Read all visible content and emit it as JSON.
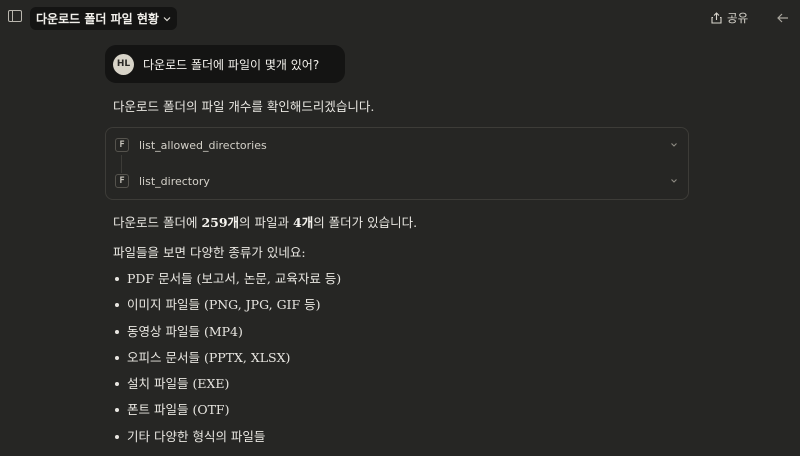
{
  "header": {
    "sidebar_icon": "sidebar-toggle-icon",
    "title": "다운로드 폴더 파일 현황",
    "share_label": "공유",
    "share_icon": "share-icon",
    "back_icon": "arrow-left-icon"
  },
  "user_message": {
    "avatar_initials": "HL",
    "text": "다운로드 폴더에 파일이 몇개 있어?"
  },
  "assistant": {
    "intro": "다운로드 폴더의 파일 개수를 확인해드리겠습니다.",
    "tools": [
      {
        "icon_letter": "F",
        "name": "list_allowed_directories"
      },
      {
        "icon_letter": "F",
        "name": "list_directory"
      }
    ],
    "summary": {
      "prefix": "다운로드 폴더에 ",
      "file_count": "259개",
      "middle": "의 파일과 ",
      "folder_count": "4개",
      "suffix": "의 폴더가 있습니다."
    },
    "types_intro": "파일들을 보면 다양한 종류가 있네요:",
    "types": [
      "PDF 문서들 (보고서, 논문, 교육자료 등)",
      "이미지 파일들 (PNG, JPG, GIF 등)",
      "동영상 파일들 (MP4)",
      "오피스 문서들 (PPTX, XLSX)",
      "설치 파일들 (EXE)",
      "폰트 파일들 (OTF)",
      "기타 다양한 형식의 파일들"
    ]
  },
  "colors": {
    "background": "#262624",
    "bubble": "#141413",
    "text": "#e8e6e1",
    "border": "#3d3c38"
  }
}
